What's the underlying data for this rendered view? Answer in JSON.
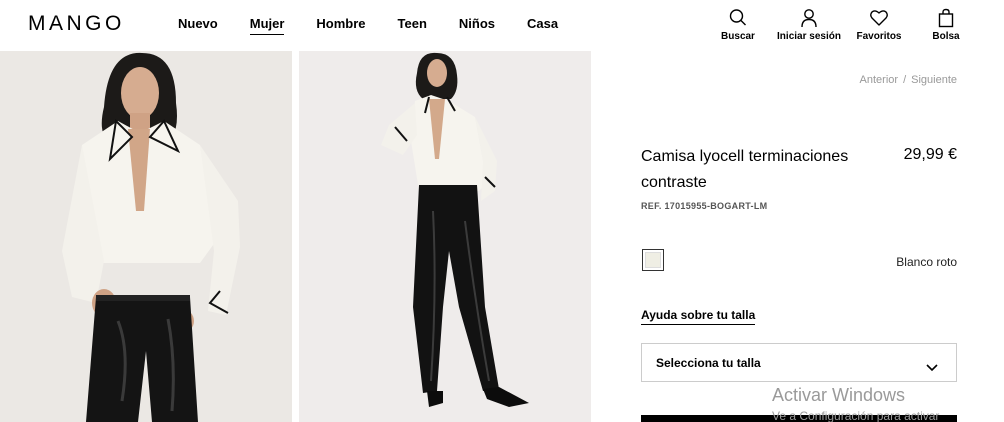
{
  "brand": {
    "logo": "MANGO"
  },
  "nav": {
    "items": [
      {
        "label": "Nuevo"
      },
      {
        "label": "Mujer"
      },
      {
        "label": "Hombre"
      },
      {
        "label": "Teen"
      },
      {
        "label": "Niños"
      },
      {
        "label": "Casa"
      }
    ],
    "active": "Mujer"
  },
  "actions": {
    "search": {
      "label": "Buscar",
      "icon": "search-icon"
    },
    "login": {
      "label": "Iniciar sesión",
      "icon": "user-icon"
    },
    "favorites": {
      "label": "Favoritos",
      "icon": "heart-icon"
    },
    "bag": {
      "label": "Bolsa",
      "icon": "bag-icon"
    }
  },
  "pager": {
    "prev": "Anterior",
    "separator": "/",
    "next": "Siguiente"
  },
  "product": {
    "title": "Camisa lyocell terminaciones contraste",
    "price": "29,99 €",
    "ref": "REF. 17015955-BOGART-LM",
    "color": {
      "name": "Blanco roto",
      "hex": "#efeee4"
    },
    "size_help": "Ayuda sobre tu talla",
    "size_placeholder": "Selecciona tu talla"
  },
  "watermark": {
    "title": "Activar Windows",
    "subtitle": "Ve a Configuración para activar"
  }
}
